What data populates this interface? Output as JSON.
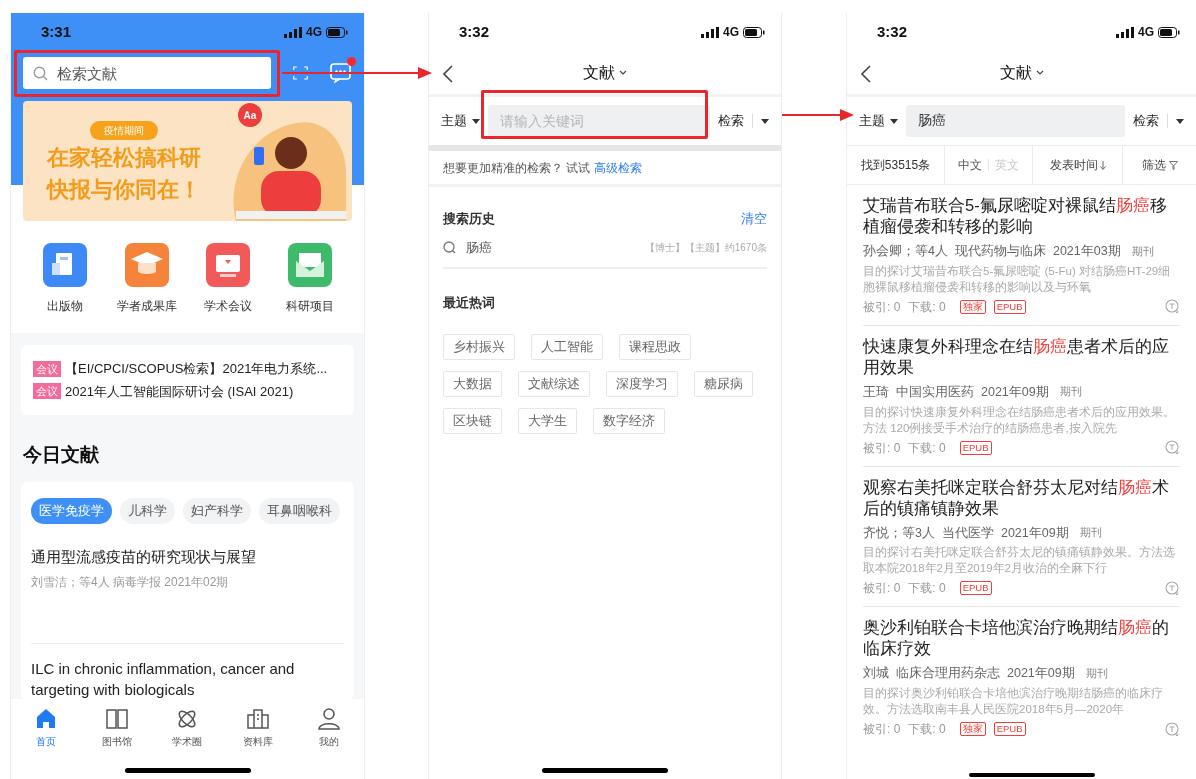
{
  "home_screen": {
    "status_bar": {
      "time": "3:31",
      "network": "4G"
    },
    "search": {
      "placeholder": "检索文献"
    },
    "has_notification": true,
    "banner": {
      "tag": "疫情期间",
      "lines": [
        "在家轻松搞科研",
        "快报与你同在！"
      ],
      "bubble": "Aa"
    },
    "shortcuts": [
      {
        "label": "出版物",
        "kind": "document",
        "color": "#3d8af7"
      },
      {
        "label": "学者成果库",
        "kind": "cap",
        "color": "#f5843a"
      },
      {
        "label": "学术会议",
        "kind": "monitor",
        "color": "#f25a5a"
      },
      {
        "label": "科研项目",
        "kind": "envelope",
        "color": "#3dba6a"
      }
    ],
    "notices": [
      {
        "tag": "会议",
        "text": "【EI/CPCI/SCOPUS检索】2021年电力系统..."
      },
      {
        "tag": "会议",
        "text": "2021年人工智能国际研讨会 (ISAI 2021)"
      }
    ],
    "section_title": "今日文献",
    "categories": [
      {
        "label": "医学免疫学",
        "selected": true
      },
      {
        "label": "儿科学",
        "selected": false
      },
      {
        "label": "妇产科学",
        "selected": false
      },
      {
        "label": "耳鼻咽喉科",
        "selected": false
      }
    ],
    "articles": [
      {
        "title": "通用型流感疫苗的研究现状与展望",
        "meta": "刘雪洁；等4人  病毒学报  2021年02期"
      },
      {
        "title": "ILC in chronic inflammation, cancer and targeting with biologicals"
      }
    ],
    "tab_bar": [
      {
        "label": "首页",
        "kind": "home",
        "selected": true
      },
      {
        "label": "图书馆",
        "kind": "book",
        "selected": false
      },
      {
        "label": "学术圈",
        "kind": "atom",
        "selected": false
      },
      {
        "label": "资料库",
        "kind": "building",
        "selected": false
      },
      {
        "label": "我的",
        "kind": "person",
        "selected": false
      }
    ]
  },
  "search_screen": {
    "status_bar": {
      "time": "3:32",
      "network": "4G"
    },
    "nav_title": "文献",
    "field_selector": "主题",
    "placeholder": "请输入关键词",
    "search_button": "检索",
    "hint": "想要更加精准的检索？ 试试",
    "advanced_link": "高级检索",
    "history": {
      "title": "搜索历史",
      "clear": "清空",
      "items": [
        {
          "keyword": "肠癌",
          "info": "【博士】【主题】约1670条"
        }
      ]
    },
    "hot": {
      "title": "最近热词",
      "words": [
        "乡村振兴",
        "人工智能",
        "课程思政",
        "大数据",
        "文献综述",
        "深度学习",
        "糖尿病",
        "区块链",
        "大学生",
        "数字经济"
      ]
    }
  },
  "results_screen": {
    "status_bar": {
      "time": "3:32",
      "network": "4G"
    },
    "nav_title": "文献",
    "field_selector": "主题",
    "query": "肠癌",
    "search_button": "检索",
    "count": "找到53515条",
    "language": [
      {
        "label": "中文",
        "selected": true
      },
      {
        "label": "英文",
        "selected": false
      }
    ],
    "sort": "发表时间",
    "filter": "筛选",
    "results": [
      {
        "title_parts": [
          {
            "text": "艾瑞昔布联合5-氟尿嘧啶对裸鼠结",
            "highlight": false
          },
          {
            "text": "肠癌",
            "highlight": true
          },
          {
            "text": "移植瘤侵袭和转移的影响",
            "highlight": false
          }
        ],
        "authors": "孙会卿；等4人",
        "journal": "现代药物与临床",
        "issue": "2021年03期",
        "type": "期刊",
        "abstract": "目的探讨艾瑞昔布联合5-氟尿嘧啶 (5-Fu) 对结肠癌HT-29细胞裸鼠移植瘤侵袭和转移的影响以及与环氧",
        "cited": "被引: 0",
        "downloads": "下载: 0",
        "badges": [
          "独家",
          "EPUB"
        ]
      },
      {
        "title_parts": [
          {
            "text": "快速康复外科理念在结",
            "highlight": false
          },
          {
            "text": "肠癌",
            "highlight": true
          },
          {
            "text": "患者术后的应用效果",
            "highlight": false
          }
        ],
        "authors": "王琦",
        "journal": "中国实用医药",
        "issue": "2021年09期",
        "type": "期刊",
        "abstract": "目的探讨快速康复外科理念在结肠癌患者术后的应用效果。方法 120例接受手术治疗的结肠癌患者,按入院先",
        "cited": "被引: 0",
        "downloads": "下载: 0",
        "badges": [
          "EPUB"
        ]
      },
      {
        "title_parts": [
          {
            "text": "观察右美托咪定联合舒芬太尼对结",
            "highlight": false
          },
          {
            "text": "肠癌",
            "highlight": true
          },
          {
            "text": "术后的镇痛镇静效果",
            "highlight": false
          }
        ],
        "authors": "齐悦；等3人",
        "journal": "当代医学",
        "issue": "2021年09期",
        "type": "期刊",
        "abstract": "目的探讨右美托咪定联合舒芬太尼的镇痛镇静效果。方法选取本院2018年2月至2019年2月收治的全麻下行",
        "cited": "被引: 0",
        "downloads": "下载: 0",
        "badges": [
          "EPUB"
        ]
      },
      {
        "title_parts": [
          {
            "text": "奥沙利铂联合卡培他滨治疗晚期结",
            "highlight": false
          },
          {
            "text": "肠癌",
            "highlight": true
          },
          {
            "text": "的临床疗效",
            "highlight": false
          }
        ],
        "authors": "刘城",
        "journal": "临床合理用药杂志",
        "issue": "2021年09期",
        "type": "期刊",
        "abstract": "目的探讨奥沙利铂联合卡培他滨治疗晚期结肠癌的临床疗效。方法选取南丰县人民医院2018年5月—2020年",
        "cited": "被引: 0",
        "downloads": "下载: 0",
        "badges": [
          "独家",
          "EPUB"
        ]
      }
    ]
  }
}
